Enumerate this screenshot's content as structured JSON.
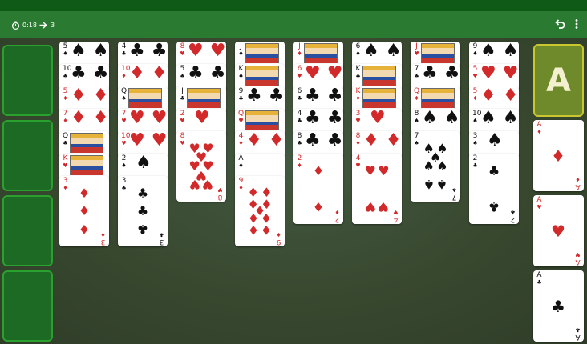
{
  "toolbar": {
    "timer": "0:18",
    "moves": "3",
    "timer_icon": "stopwatch-icon",
    "moves_icon": "arrow-right-icon",
    "undo_icon": "undo-icon",
    "menu_icon": "more-vert-icon"
  },
  "foundation": {
    "placeholder": "A",
    "cards": [
      {
        "rank": "A",
        "suit": "♦",
        "color": "red"
      },
      {
        "rank": "A",
        "suit": "♥",
        "color": "red"
      },
      {
        "rank": "A",
        "suit": "♣",
        "color": "black"
      }
    ]
  },
  "free_cells": 4,
  "columns": [
    [
      {
        "rank": "5",
        "suit": "♠",
        "color": "black"
      },
      {
        "rank": "10",
        "suit": "♣",
        "color": "black"
      },
      {
        "rank": "5",
        "suit": "♦",
        "color": "red"
      },
      {
        "rank": "7",
        "suit": "♦",
        "color": "red"
      },
      {
        "rank": "Q",
        "suit": "♣",
        "color": "black"
      },
      {
        "rank": "K",
        "suit": "♥",
        "color": "red"
      },
      {
        "rank": "3",
        "suit": "♦",
        "color": "red"
      }
    ],
    [
      {
        "rank": "4",
        "suit": "♣",
        "color": "black"
      },
      {
        "rank": "10",
        "suit": "♦",
        "color": "red"
      },
      {
        "rank": "Q",
        "suit": "♠",
        "color": "black"
      },
      {
        "rank": "7",
        "suit": "♥",
        "color": "red"
      },
      {
        "rank": "10",
        "suit": "♥",
        "color": "red"
      },
      {
        "rank": "2",
        "suit": "♠",
        "color": "black"
      },
      {
        "rank": "3",
        "suit": "♣",
        "color": "black"
      }
    ],
    [
      {
        "rank": "8",
        "suit": "♥",
        "color": "red"
      },
      {
        "rank": "5",
        "suit": "♣",
        "color": "black"
      },
      {
        "rank": "J",
        "suit": "♣",
        "color": "black"
      },
      {
        "rank": "2",
        "suit": "♥",
        "color": "red"
      },
      {
        "rank": "8",
        "suit": "♥",
        "color": "red"
      }
    ],
    [
      {
        "rank": "J",
        "suit": "♠",
        "color": "black"
      },
      {
        "rank": "K",
        "suit": "♠",
        "color": "black"
      },
      {
        "rank": "9",
        "suit": "♣",
        "color": "black"
      },
      {
        "rank": "Q",
        "suit": "♥",
        "color": "red"
      },
      {
        "rank": "4",
        "suit": "♦",
        "color": "red"
      },
      {
        "rank": "A",
        "suit": "♠",
        "color": "black"
      },
      {
        "rank": "9",
        "suit": "♦",
        "color": "red"
      }
    ],
    [
      {
        "rank": "J",
        "suit": "♦",
        "color": "red"
      },
      {
        "rank": "6",
        "suit": "♥",
        "color": "red"
      },
      {
        "rank": "6",
        "suit": "♣",
        "color": "black"
      },
      {
        "rank": "4",
        "suit": "♣",
        "color": "black"
      },
      {
        "rank": "8",
        "suit": "♣",
        "color": "black"
      },
      {
        "rank": "2",
        "suit": "♦",
        "color": "red"
      }
    ],
    [
      {
        "rank": "6",
        "suit": "♠",
        "color": "black"
      },
      {
        "rank": "K",
        "suit": "♣",
        "color": "black"
      },
      {
        "rank": "K",
        "suit": "♦",
        "color": "red"
      },
      {
        "rank": "3",
        "suit": "♥",
        "color": "red"
      },
      {
        "rank": "8",
        "suit": "♦",
        "color": "red"
      },
      {
        "rank": "4",
        "suit": "♥",
        "color": "red"
      }
    ],
    [
      {
        "rank": "J",
        "suit": "♥",
        "color": "red"
      },
      {
        "rank": "7",
        "suit": "♣",
        "color": "black"
      },
      {
        "rank": "Q",
        "suit": "♦",
        "color": "red"
      },
      {
        "rank": "8",
        "suit": "♠",
        "color": "black"
      },
      {
        "rank": "7",
        "suit": "♠",
        "color": "black"
      }
    ],
    [
      {
        "rank": "9",
        "suit": "♠",
        "color": "black"
      },
      {
        "rank": "5",
        "suit": "♥",
        "color": "red"
      },
      {
        "rank": "5",
        "suit": "♦",
        "color": "red"
      },
      {
        "rank": "10",
        "suit": "♠",
        "color": "black"
      },
      {
        "rank": "3",
        "suit": "♠",
        "color": "black"
      },
      {
        "rank": "2",
        "suit": "♣",
        "color": "black"
      }
    ]
  ]
}
